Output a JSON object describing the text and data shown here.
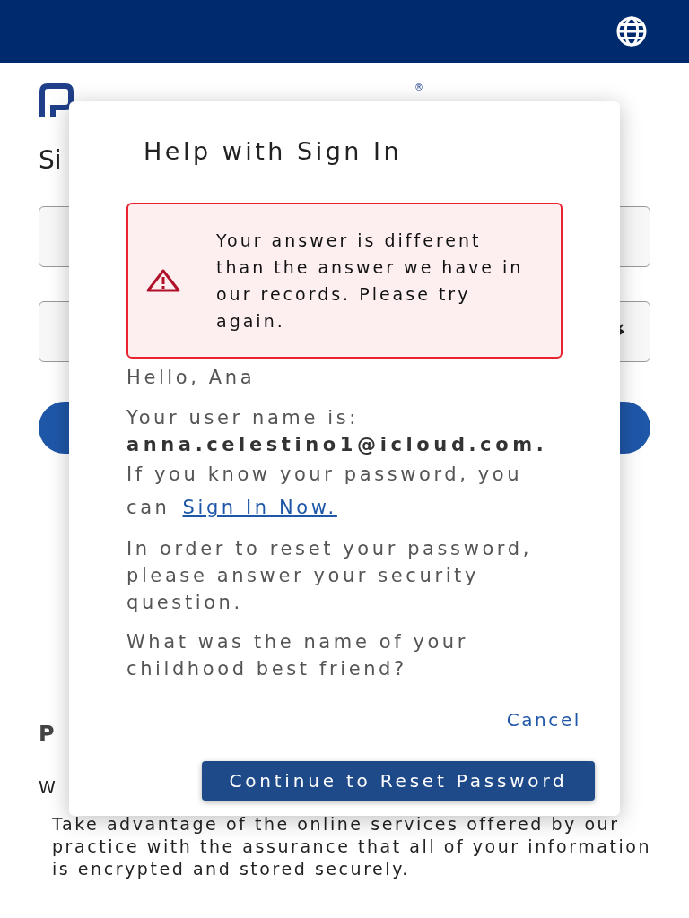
{
  "background_page": {
    "logo_mark": "®",
    "heading": "Si",
    "section_heading": "P",
    "section_text": "W",
    "paragraph": "Take advantage of the online services offered by our practice with the assurance that all of your information is encrypted and stored securely."
  },
  "dialog": {
    "title": "Help with Sign In",
    "error": {
      "kind": "warning",
      "text": "Your answer is different than the answer we have in our records. Please try again."
    },
    "greeting": "Hello, Ana",
    "username_label": "Your user name is:",
    "username": "anna.celestino1@icloud.com.",
    "sign_in_prefix": "If you know your password, you can",
    "sign_in_link": "Sign In Now.",
    "reset_text": "In order to reset your password, please answer your security question.",
    "question": "What was the name of your childhood best friend?",
    "cancel": "Cancel",
    "continue": "Continue to Reset Password"
  }
}
